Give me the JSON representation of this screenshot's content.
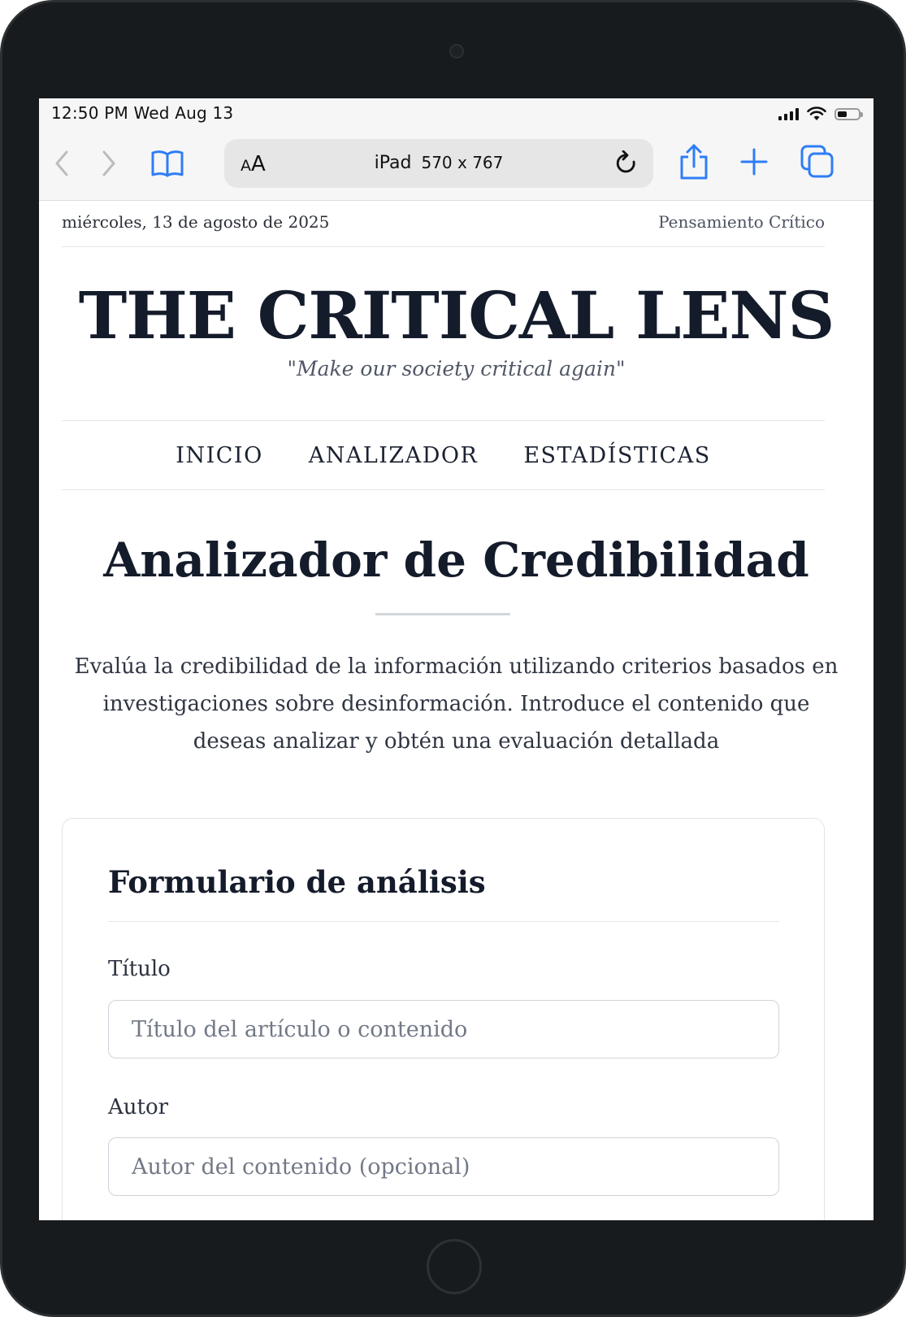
{
  "status_bar": {
    "time": "12:50 PM  Wed Aug 13"
  },
  "browser": {
    "text_size_label": "AA",
    "address_device": "iPad",
    "address_dims": "570 x 767"
  },
  "page": {
    "date": "miércoles, 13 de agosto de 2025",
    "section": "Pensamiento Crítico",
    "masthead": "THE CRITICAL LENS",
    "tagline": "\"Make our society critical again\"",
    "nav": [
      "INICIO",
      "ANALIZADOR",
      "ESTADÍSTICAS"
    ],
    "title": "Analizador de Credibilidad",
    "intro": "Evalúa la credibilidad de la información utilizando criterios basados en investigaciones sobre desinformación. Introduce el contenido que deseas analizar y obtén una evaluación detallada"
  },
  "form": {
    "heading": "Formulario de análisis",
    "title_label": "Título",
    "title_placeholder": "Título del artículo o contenido",
    "author_label": "Autor",
    "author_placeholder": "Autor del contenido (opcional)"
  },
  "colors": {
    "accent": "#2f7df6",
    "ink": "#141b2a"
  }
}
